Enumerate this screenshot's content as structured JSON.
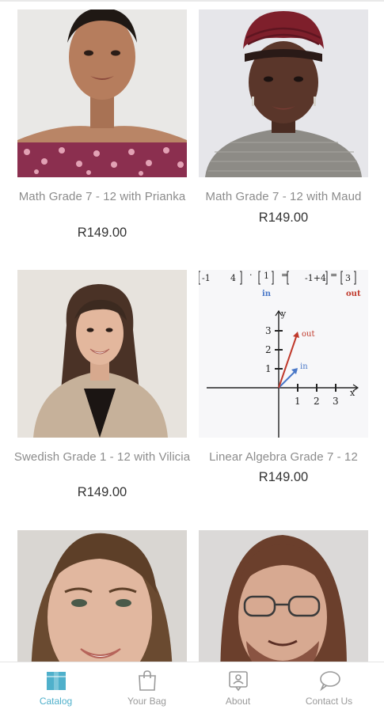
{
  "products": [
    {
      "title": "Math Grade 7 - 12 with Prianka",
      "price": "R149.00"
    },
    {
      "title": "Math Grade 7 - 12 with Maud",
      "price": "R149.00"
    },
    {
      "title": "Swedish Grade 1 - 12 with Vilicia",
      "price": "R149.00"
    },
    {
      "title": "Linear Algebra Grade 7 - 12",
      "price": "R149.00"
    },
    {
      "title": "",
      "price": ""
    },
    {
      "title": "",
      "price": ""
    }
  ],
  "la_figure": {
    "equation_fragments": [
      "-1",
      "4",
      "1",
      "-1+4",
      "3"
    ],
    "in_label": "in",
    "out_label": "out",
    "axis_x": "x",
    "axis_y": "y",
    "x_ticks": [
      "1",
      "2",
      "3"
    ],
    "y_ticks": [
      "1",
      "2",
      "3"
    ]
  },
  "nav": {
    "items": [
      {
        "label": "Catalog",
        "icon": "catalog-box-icon",
        "active": true
      },
      {
        "label": "Your Bag",
        "icon": "shopping-bag-icon",
        "active": false
      },
      {
        "label": "About",
        "icon": "about-person-icon",
        "active": false
      },
      {
        "label": "Contact Us",
        "icon": "chat-bubble-icon",
        "active": false
      }
    ]
  },
  "colors": {
    "accent": "#4fb0cb",
    "inactive": "#9a9a9a",
    "title_text": "#8c8c8c",
    "price_text": "#333333",
    "vector_in": "#4a78c8",
    "vector_out": "#c0392b"
  }
}
